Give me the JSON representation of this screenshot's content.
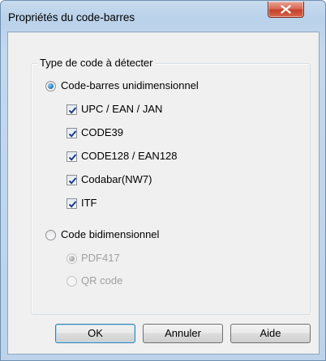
{
  "window": {
    "title": "Propriétés du code-barres",
    "close_label": "x"
  },
  "group": {
    "legend": "Type de code à détecter"
  },
  "options": {
    "one_d": {
      "label": "Code-barres unidimensionnel",
      "selected": true
    },
    "one_d_types": [
      {
        "label": "UPC / EAN / JAN",
        "checked": true
      },
      {
        "label": "CODE39",
        "checked": true
      },
      {
        "label": "CODE128 / EAN128",
        "checked": true
      },
      {
        "label": "Codabar(NW7)",
        "checked": true
      },
      {
        "label": "ITF",
        "checked": true
      }
    ],
    "two_d": {
      "label": "Code bidimensionnel",
      "selected": false
    },
    "two_d_types": [
      {
        "label": "PDF417",
        "selected": true,
        "enabled": false
      },
      {
        "label": "QR code",
        "selected": false,
        "enabled": false
      }
    ]
  },
  "buttons": {
    "ok": "OK",
    "cancel": "Annuler",
    "help": "Aide"
  },
  "colors": {
    "frame": "#c4d8ec",
    "client": "#f0f0f0",
    "close_button": "#c3422b",
    "disabled_text": "#a0a0a0"
  }
}
